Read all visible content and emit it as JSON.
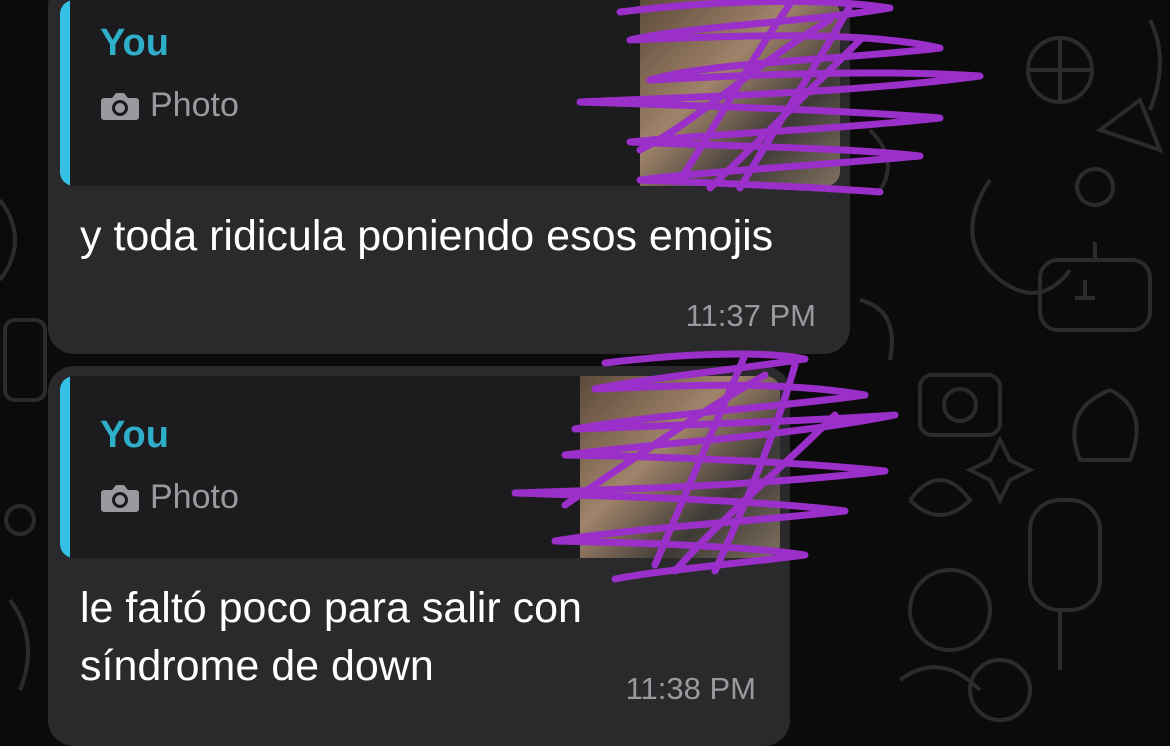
{
  "chat": {
    "messages": [
      {
        "quote": {
          "author": "You",
          "media_label": "Photo",
          "media_icon": "camera-icon"
        },
        "text": "y toda ridicula poniendo esos emojis",
        "time": "11:37 PM"
      },
      {
        "quote": {
          "author": "You",
          "media_label": "Photo",
          "media_icon": "camera-icon"
        },
        "text": "le faltó poco para salir con síndrome de down",
        "time": "11:38 PM"
      }
    ]
  },
  "colors": {
    "background": "#0b0b0b",
    "bubble": "#2a2a2c",
    "quote_background": "#1c1c1e",
    "quote_bar": "#35c2e6",
    "quote_author": "#2eaec9",
    "text": "#ffffff",
    "meta_text": "#9a9a9e",
    "redaction": "#9b2fc9"
  }
}
